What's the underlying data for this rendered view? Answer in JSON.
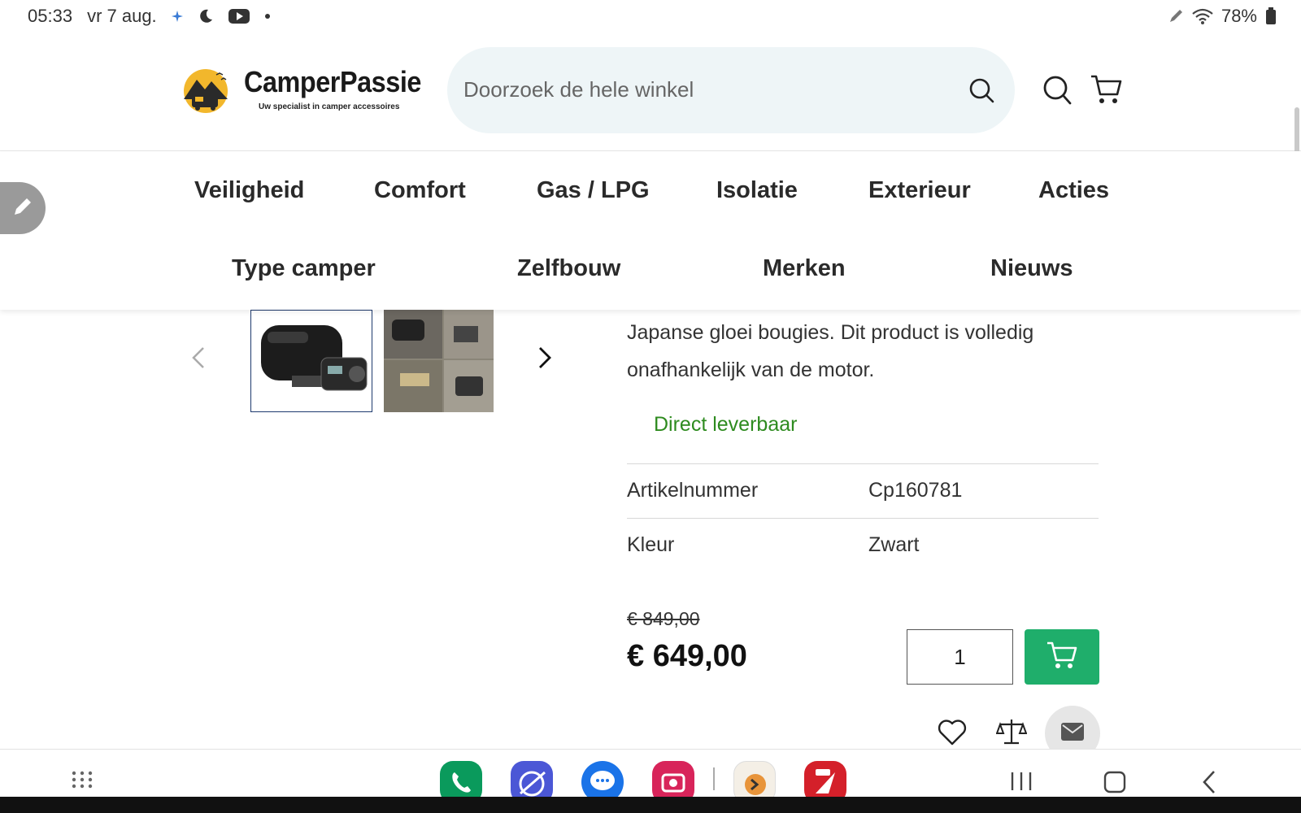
{
  "status_bar": {
    "time": "05:33",
    "date": "vr 7 aug.",
    "battery": "78%",
    "icons": [
      "sparkle-icon",
      "moon-icon",
      "youtube-icon",
      "dot-icon",
      "pen-icon",
      "wifi-icon",
      "battery-icon"
    ]
  },
  "header": {
    "logo_title": "CamperPassie",
    "logo_subtitle": "Uw specialist in camper accessoires",
    "search_placeholder": "Doorzoek de hele winkel",
    "icons": [
      "search-icon",
      "cart-icon"
    ]
  },
  "nav": {
    "row1": [
      "Veiligheid",
      "Comfort",
      "Gas / LPG",
      "Isolatie",
      "Exterieur",
      "Acties"
    ],
    "row2": [
      "Type camper",
      "Zelfbouw",
      "Merken",
      "Nieuws"
    ]
  },
  "product": {
    "description": "Japanse gloei bougies. Dit product is volledig onafhankelijk van de motor.",
    "stock": "Direct leverbaar",
    "specs": [
      {
        "key": "Artikelnummer",
        "value": "Cp160781"
      },
      {
        "key": "Kleur",
        "value": "Zwart"
      }
    ],
    "old_price": "€ 849,00",
    "price": "€ 649,00",
    "quantity": "1"
  },
  "colors": {
    "accent_green": "#1fae6b",
    "stock_green": "#2e8b1f",
    "search_bg": "#eef5f7"
  },
  "dock": {
    "apps": [
      "phone-app-icon",
      "browser-app-icon",
      "messages-app-icon",
      "camera-app-icon",
      "sigma-app-icon",
      "pro-app-icon"
    ],
    "nav_icons": [
      "apps-grid-icon",
      "recents-icon",
      "home-icon",
      "back-icon"
    ]
  }
}
